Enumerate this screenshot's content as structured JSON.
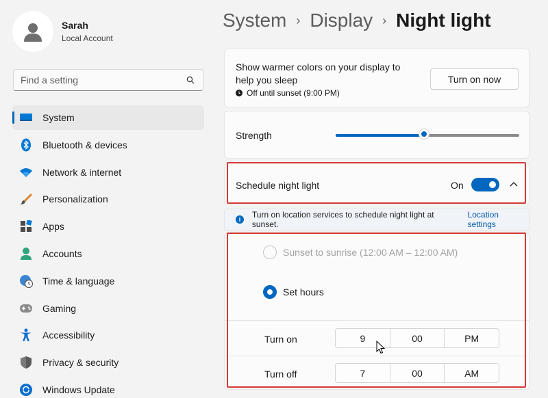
{
  "profile": {
    "name": "Sarah",
    "account_type": "Local Account"
  },
  "search": {
    "placeholder": "Find a setting"
  },
  "sidebar": {
    "items": [
      {
        "label": "System",
        "icon": "monitor-icon",
        "active": true
      },
      {
        "label": "Bluetooth & devices",
        "icon": "bluetooth-icon"
      },
      {
        "label": "Network & internet",
        "icon": "wifi-icon"
      },
      {
        "label": "Personalization",
        "icon": "brush-icon"
      },
      {
        "label": "Apps",
        "icon": "apps-icon"
      },
      {
        "label": "Accounts",
        "icon": "person-icon"
      },
      {
        "label": "Time & language",
        "icon": "globe-clock-icon"
      },
      {
        "label": "Gaming",
        "icon": "gamepad-icon"
      },
      {
        "label": "Accessibility",
        "icon": "accessibility-icon"
      },
      {
        "label": "Privacy & security",
        "icon": "shield-icon"
      },
      {
        "label": "Windows Update",
        "icon": "update-icon"
      }
    ]
  },
  "breadcrumb": {
    "level1": "System",
    "level2": "Display",
    "current": "Night light"
  },
  "night_light": {
    "description": "Show warmer colors on your display to help you sleep",
    "status": "Off until sunset (9:00 PM)",
    "turn_on_button": "Turn on now"
  },
  "strength": {
    "label": "Strength",
    "value_percent": 48
  },
  "schedule": {
    "label": "Schedule night light",
    "state_text": "On",
    "enabled": true
  },
  "info": {
    "text": "Turn on location services to schedule night light at sunset.",
    "link": "Location settings"
  },
  "options": {
    "sunset_label": "Sunset to sunrise (12:00 AM – 12:00 AM)",
    "set_hours_label": "Set hours"
  },
  "turn_on": {
    "label": "Turn on",
    "hour": "9",
    "minute": "00",
    "period": "PM"
  },
  "turn_off": {
    "label": "Turn off",
    "hour": "7",
    "minute": "00",
    "period": "AM"
  },
  "colors": {
    "accent": "#0067c0",
    "highlight": "#d33a36"
  }
}
